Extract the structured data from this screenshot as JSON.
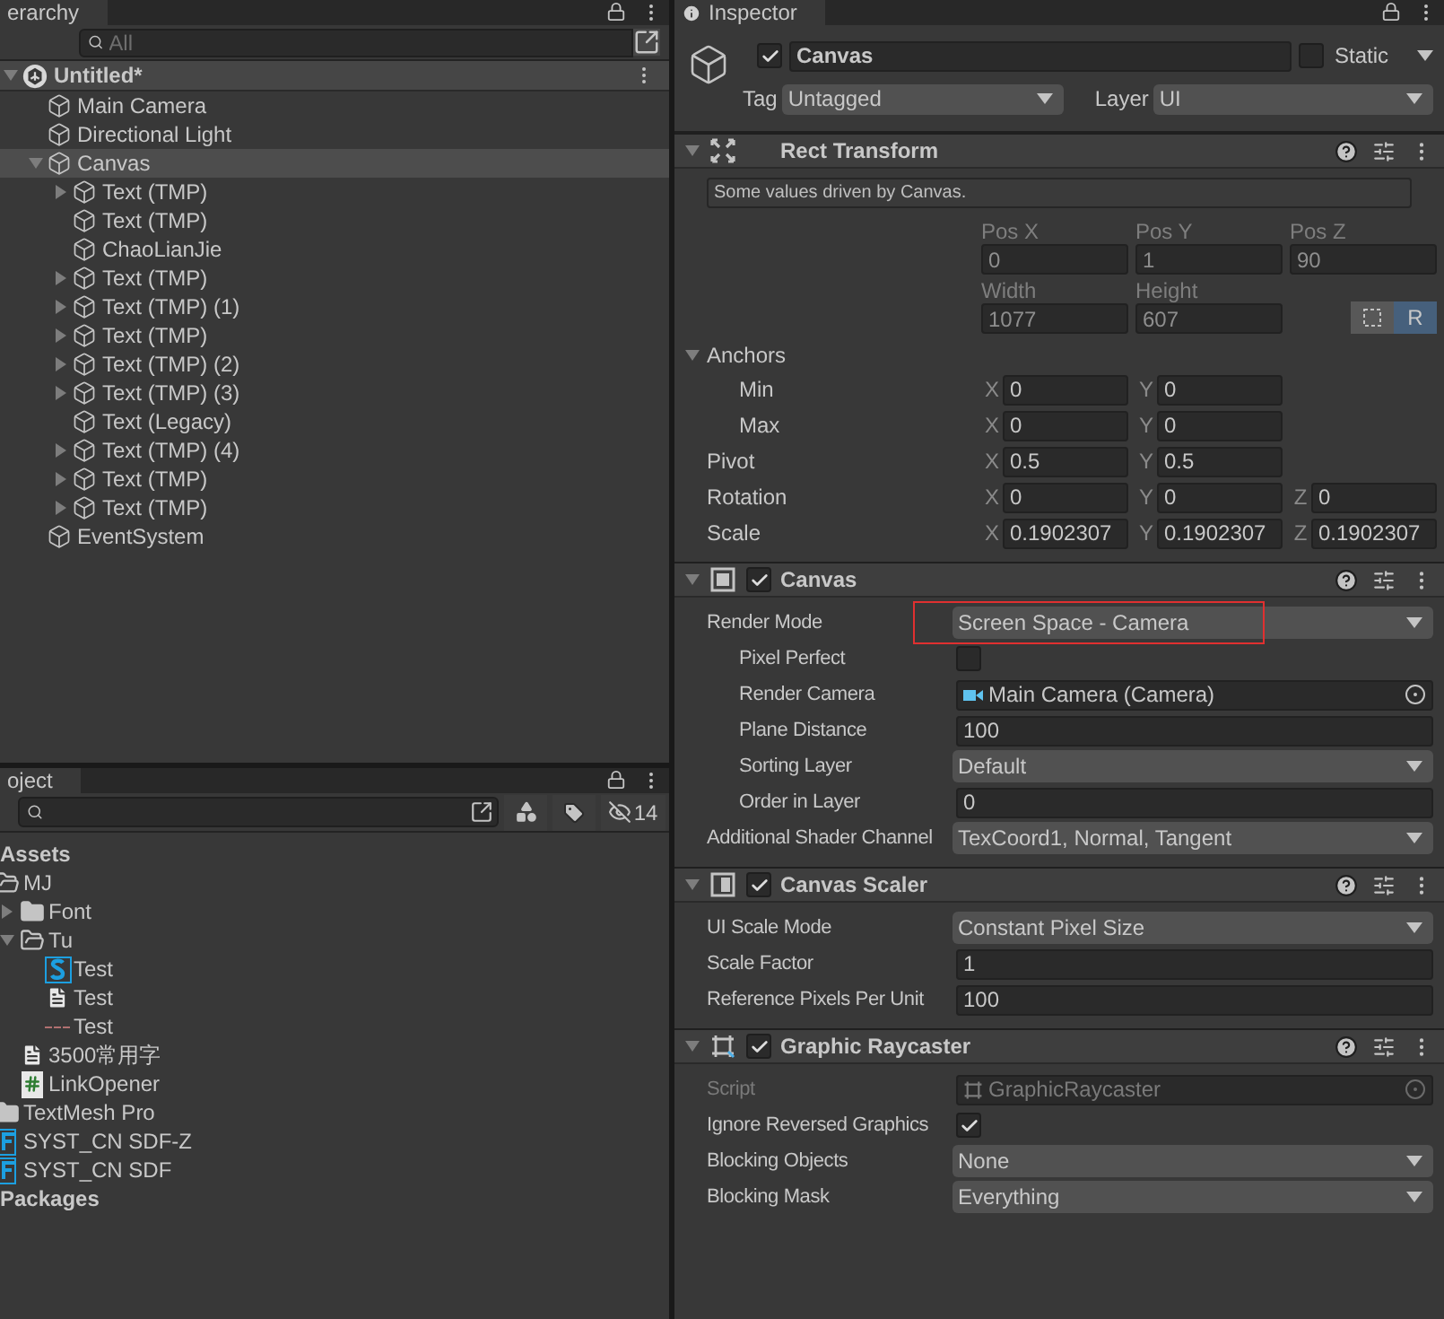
{
  "hierarchy": {
    "tab": "erarchy",
    "search": {
      "placeholder": "All"
    },
    "scene": {
      "label": "Untitled*",
      "expanded": true,
      "children": [
        {
          "label": "Main Camera",
          "selected": false
        },
        {
          "label": "Directional Light",
          "selected": false
        },
        {
          "label": "Canvas",
          "expanded": true,
          "selected": true,
          "children": [
            {
              "label": "Text (TMP)",
              "expanded": false,
              "selected": false
            },
            {
              "label": "Text (TMP)",
              "selected": false
            },
            {
              "label": "ChaoLianJie",
              "selected": false
            },
            {
              "label": "Text (TMP)",
              "expanded": false,
              "selected": false
            },
            {
              "label": "Text (TMP) (1)",
              "expanded": false,
              "selected": false
            },
            {
              "label": "Text (TMP)",
              "expanded": false,
              "selected": false
            },
            {
              "label": "Text (TMP) (2)",
              "expanded": false,
              "selected": false
            },
            {
              "label": "Text (TMP) (3)",
              "expanded": false,
              "selected": false
            },
            {
              "label": "Text (Legacy)",
              "selected": false
            },
            {
              "label": "Text (TMP) (4)",
              "expanded": false,
              "selected": false
            },
            {
              "label": "Text (TMP)",
              "expanded": false,
              "selected": false
            },
            {
              "label": "Text (TMP)",
              "expanded": false,
              "selected": false
            }
          ]
        },
        {
          "label": "EventSystem",
          "selected": false
        }
      ]
    }
  },
  "project": {
    "tab": "oject",
    "hidden_count": "14",
    "tree": [
      {
        "label": "Assets",
        "kind": "header",
        "children": [
          {
            "label": "MJ",
            "kind": "folder",
            "expanded": true,
            "children": [
              {
                "label": "Font",
                "kind": "folder",
                "expanded": false
              },
              {
                "label": "Tu",
                "kind": "folder",
                "expanded": true,
                "children": [
                  {
                    "label": "Test",
                    "kind": "shader"
                  },
                  {
                    "label": "Test",
                    "kind": "text"
                  },
                  {
                    "label": "Test",
                    "kind": "line"
                  }
                ]
              },
              {
                "label": "3500常用字",
                "kind": "text"
              },
              {
                "label": "LinkOpener",
                "kind": "script"
              }
            ]
          },
          {
            "label": "TextMesh Pro",
            "kind": "folder",
            "expanded": false
          },
          {
            "label": "SYST_CN SDF-Z",
            "kind": "font"
          },
          {
            "label": "SYST_CN SDF",
            "kind": "font"
          }
        ]
      },
      {
        "label": "Packages",
        "kind": "header"
      }
    ]
  },
  "inspector": {
    "tab": "Inspector",
    "object": {
      "active": true,
      "name": "Canvas",
      "static": false,
      "static_label": "Static",
      "tag_label": "Tag",
      "tag": "Untagged",
      "layer_label": "Layer",
      "layer": "UI"
    },
    "components": [
      {
        "kind": "rect_transform",
        "title": "Rect Transform",
        "expanded": true,
        "note": "Some values driven by Canvas.",
        "position": [
          {
            "label": "Pos X",
            "value": "0"
          },
          {
            "label": "Pos Y",
            "value": "1"
          },
          {
            "label": "Pos Z",
            "value": "90"
          }
        ],
        "size": [
          {
            "label": "Width",
            "value": "1077"
          },
          {
            "label": "Height",
            "value": "607"
          }
        ],
        "edit_modes": [
          {
            "kind": "blueprint",
            "selected": false
          },
          {
            "kind": "raw",
            "label": "R",
            "selected": true
          }
        ],
        "anchors": {
          "label": "Anchors",
          "expanded": true,
          "children": [
            {
              "label": "Min",
              "fields": [
                {
                  "axis": "X",
                  "value": "0"
                },
                {
                  "axis": "Y",
                  "value": "0"
                }
              ]
            },
            {
              "label": "Max",
              "fields": [
                {
                  "axis": "X",
                  "value": "0"
                },
                {
                  "axis": "Y",
                  "value": "0"
                }
              ]
            }
          ]
        },
        "vectors": [
          {
            "label": "Pivot",
            "fields": [
              {
                "axis": "X",
                "value": "0.5"
              },
              {
                "axis": "Y",
                "value": "0.5"
              }
            ]
          },
          {
            "label": "Rotation",
            "fields": [
              {
                "axis": "X",
                "value": "0"
              },
              {
                "axis": "Y",
                "value": "0"
              },
              {
                "axis": "Z",
                "value": "0"
              }
            ]
          },
          {
            "label": "Scale",
            "fields": [
              {
                "axis": "X",
                "value": "0.1902307"
              },
              {
                "axis": "Y",
                "value": "0.1902307"
              },
              {
                "axis": "Z",
                "value": "0.1902307"
              }
            ]
          }
        ]
      },
      {
        "kind": "canvas",
        "title": "Canvas",
        "enabled": true,
        "expanded": true,
        "fields": [
          {
            "label": "Render Mode",
            "kind": "dropdown",
            "value": "Screen Space - Camera",
            "highlighted": true,
            "children": [
              {
                "label": "Pixel Perfect",
                "kind": "checkbox",
                "checked": false
              },
              {
                "label": "Render Camera",
                "kind": "camera_object",
                "value": "Main Camera (Camera)"
              },
              {
                "label": "Plane Distance",
                "kind": "number",
                "value": "100"
              },
              {
                "label": "Sorting Layer",
                "kind": "dropdown",
                "value": "Default"
              },
              {
                "label": "Order in Layer",
                "kind": "number",
                "value": "0"
              }
            ]
          },
          {
            "label": "Additional Shader Channel",
            "kind": "dropdown",
            "value": "TexCoord1, Normal, Tangent"
          }
        ]
      },
      {
        "kind": "canvas_scaler",
        "title": "Canvas Scaler",
        "enabled": true,
        "expanded": true,
        "fields": [
          {
            "label": "UI Scale Mode",
            "kind": "dropdown",
            "value": "Constant Pixel Size"
          },
          {
            "label": "Scale Factor",
            "kind": "number",
            "value": "1"
          },
          {
            "label": "Reference Pixels Per Unit",
            "kind": "number",
            "value": "100"
          }
        ]
      },
      {
        "kind": "graphic_raycaster",
        "title": "Graphic Raycaster",
        "enabled": true,
        "expanded": true,
        "fields": [
          {
            "label": "Script",
            "kind": "script_object",
            "value": "GraphicRaycaster",
            "disabled": true
          },
          {
            "label": "Ignore Reversed Graphics",
            "kind": "checkbox",
            "checked": true
          },
          {
            "label": "Blocking Objects",
            "kind": "dropdown",
            "value": "None"
          },
          {
            "label": "Blocking Mask",
            "kind": "dropdown",
            "value": "Everything"
          }
        ]
      }
    ]
  }
}
